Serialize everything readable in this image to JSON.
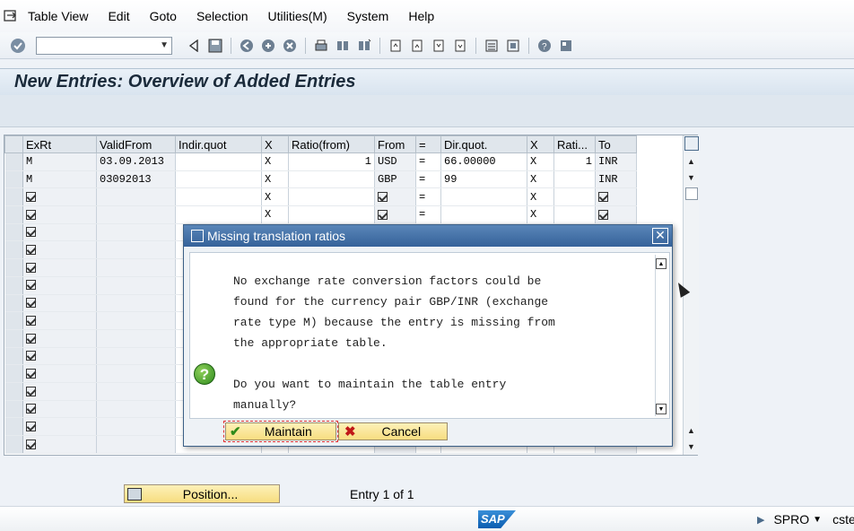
{
  "menubar": {
    "items": [
      "Table View",
      "Edit",
      "Goto",
      "Selection",
      "Utilities(M)",
      "System",
      "Help"
    ]
  },
  "page": {
    "title": "New Entries: Overview of Added Entries"
  },
  "table": {
    "columns": [
      "ExRt",
      "ValidFrom",
      "Indir.quot",
      "X",
      "Ratio(from)",
      "From",
      "=",
      "Dir.quot.",
      "X",
      "Rati...",
      "To"
    ],
    "rows": [
      {
        "exrt": "M",
        "validfrom": "03.09.2013",
        "indir": "",
        "x1": "X",
        "ratio_from": "1",
        "from": "USD",
        "eq": "=",
        "dir": "66.00000",
        "x2": "X",
        "ratio_to": "1",
        "to": "INR"
      },
      {
        "exrt": "M",
        "validfrom": "03092013",
        "indir": "",
        "x1": "X",
        "ratio_from": "",
        "from": "GBP",
        "eq": "=",
        "dir": "99",
        "x2": "X",
        "ratio_to": "",
        "to": "INR"
      },
      {
        "x1": "X",
        "eq": "=",
        "x2": "X"
      },
      {
        "x1": "X",
        "eq": "=",
        "x2": "X"
      }
    ],
    "empty_row_count": 13
  },
  "bottom": {
    "position_label": "Position...",
    "entry_info": "Entry 1 of 1"
  },
  "status": {
    "logo": "SAP",
    "transaction": "SPRO",
    "user": "cstel"
  },
  "dialog": {
    "title": "Missing translation ratios",
    "message": "No exchange rate conversion factors could be\nfound for the currency pair GBP/INR (exchange\nrate type M) because the entry is missing from\nthe appropriate table.",
    "question": "Do you want to maintain the table entry\nmanually?",
    "maintain_label": "Maintain",
    "cancel_label": "Cancel"
  }
}
